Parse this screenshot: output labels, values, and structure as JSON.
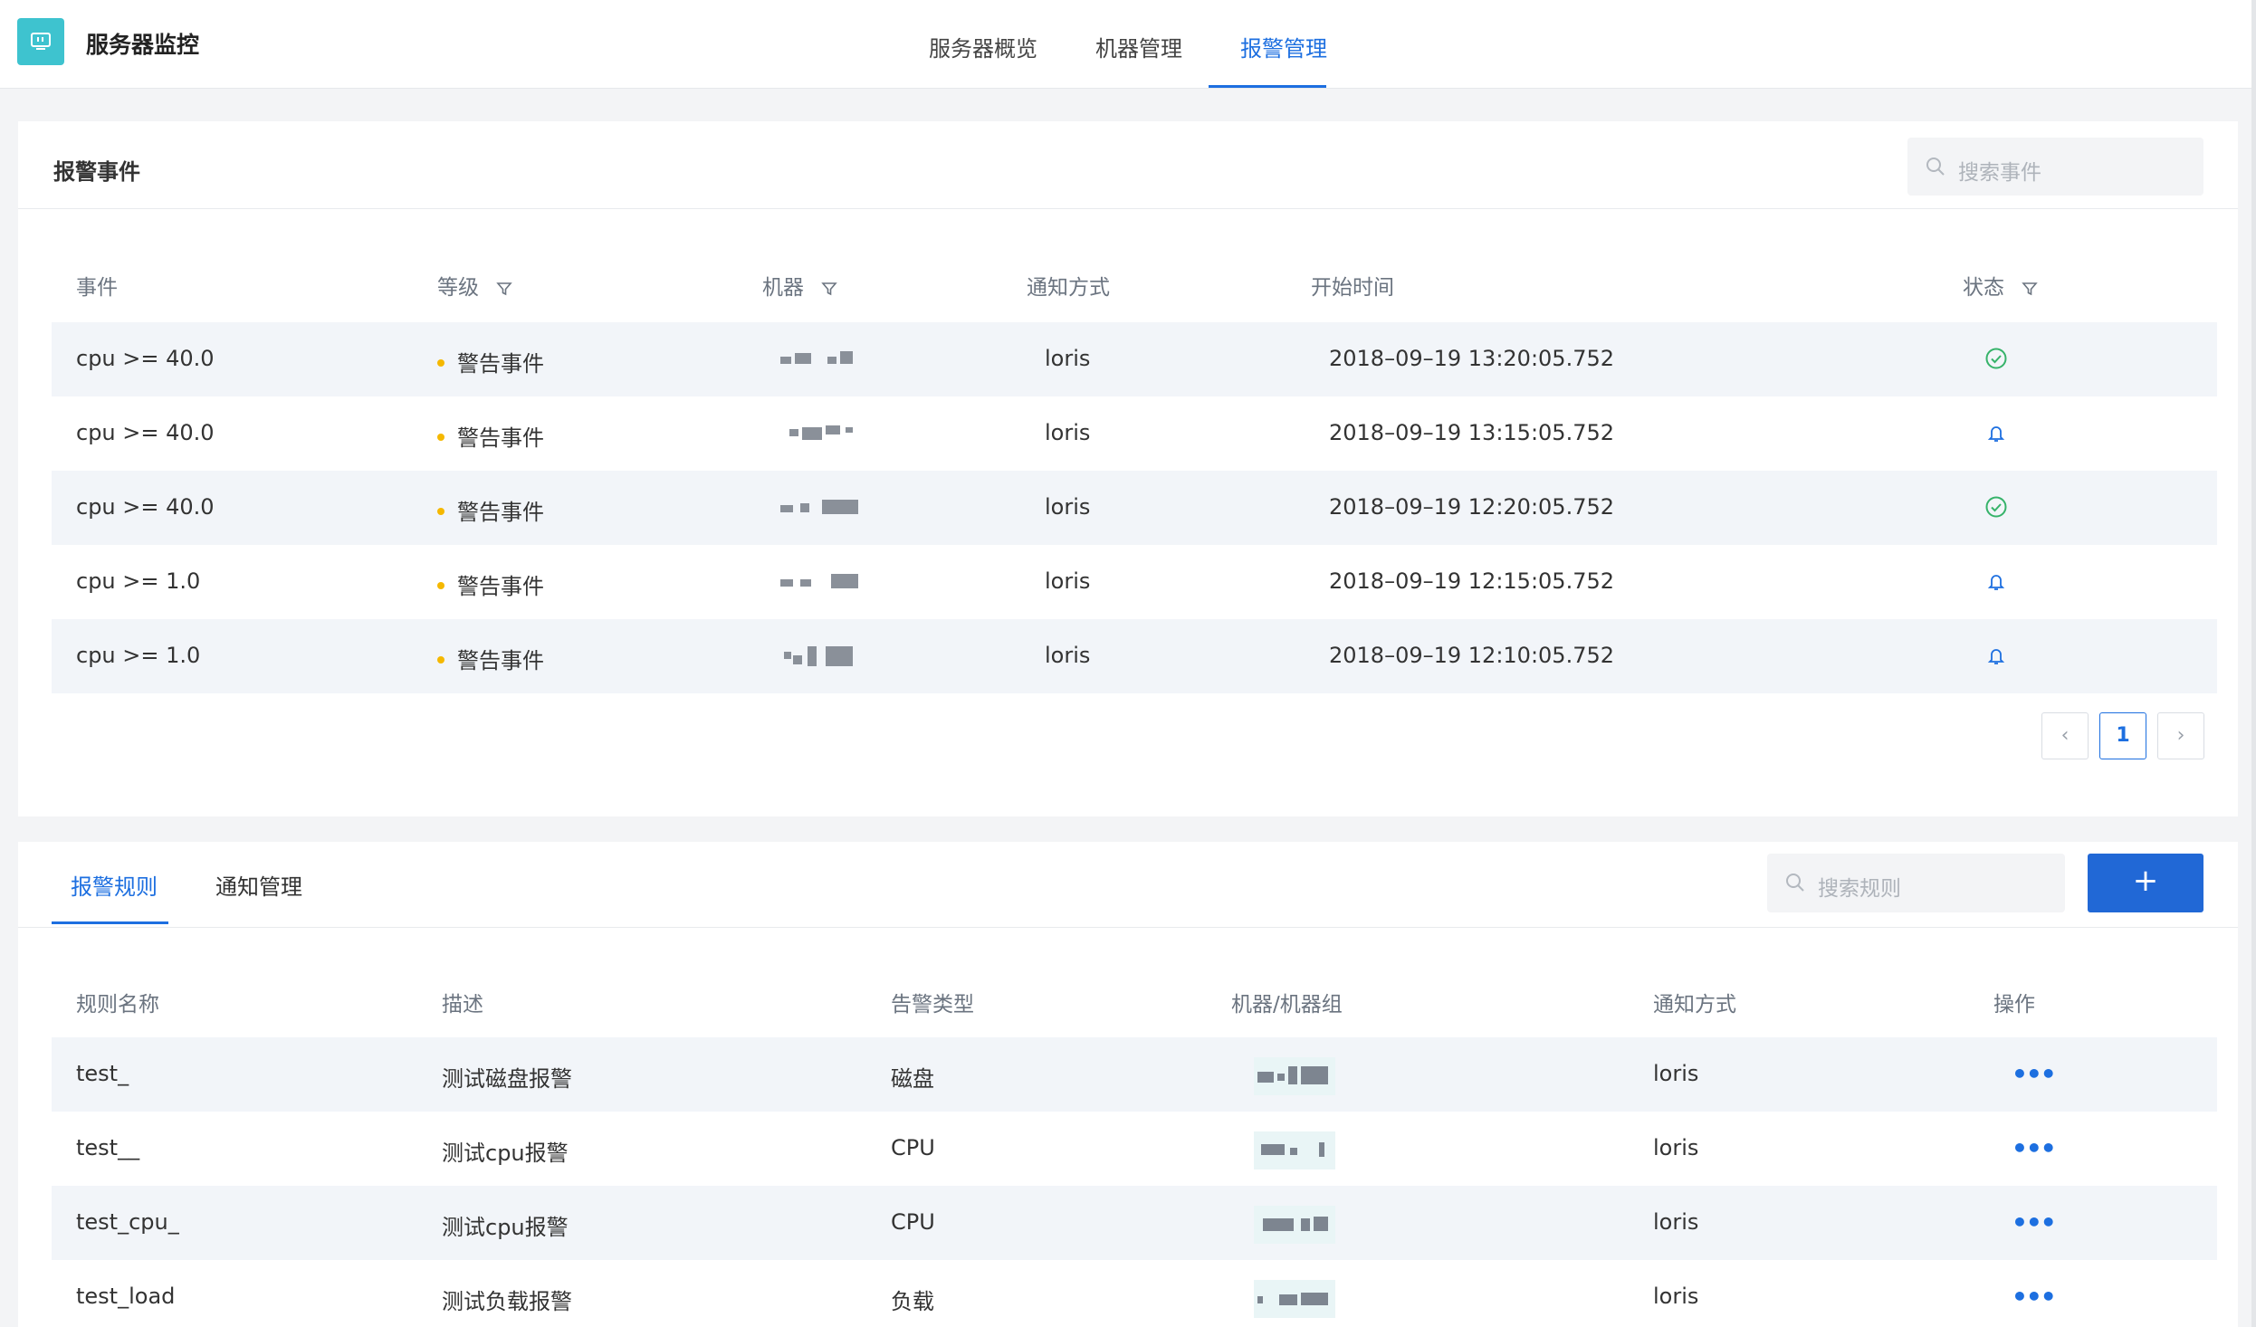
{
  "app": {
    "title": "服务器监控"
  },
  "nav": {
    "tabs": [
      {
        "label": "服务器概览"
      },
      {
        "label": "机器管理"
      },
      {
        "label": "报警管理"
      }
    ],
    "active_index": 2
  },
  "events": {
    "title": "报警事件",
    "search_placeholder": "搜索事件",
    "columns": [
      "事件",
      "等级",
      "机器",
      "通知方式",
      "开始时间",
      "状态"
    ],
    "rows": [
      {
        "event": "cpu >= 40.0",
        "level": "警告事件",
        "notify": "loris",
        "start": "2018–09–19 13:20:05.752",
        "status": "resolved"
      },
      {
        "event": "cpu >= 40.0",
        "level": "警告事件",
        "notify": "loris",
        "start": "2018–09–19 13:15:05.752",
        "status": "alerting"
      },
      {
        "event": "cpu >= 40.0",
        "level": "警告事件",
        "notify": "loris",
        "start": "2018–09–19 12:20:05.752",
        "status": "resolved"
      },
      {
        "event": "cpu >= 1.0",
        "level": "警告事件",
        "notify": "loris",
        "start": "2018–09–19 12:15:05.752",
        "status": "alerting"
      },
      {
        "event": "cpu >= 1.0",
        "level": "警告事件",
        "notify": "loris",
        "start": "2018–09–19 12:10:05.752",
        "status": "alerting"
      }
    ],
    "pagination": {
      "prev": "‹",
      "current": "1",
      "next": "›"
    }
  },
  "rules": {
    "tabs": [
      {
        "label": "报警规则"
      },
      {
        "label": "通知管理"
      }
    ],
    "active_index": 0,
    "search_placeholder": "搜索规则",
    "add_label": "+",
    "columns": [
      "规则名称",
      "描述",
      "告警类型",
      "机器/机器组",
      "通知方式",
      "操作"
    ],
    "rows": [
      {
        "name": "test_",
        "desc": "测试磁盘报警",
        "type": "磁盘",
        "notify": "loris",
        "action": "•••"
      },
      {
        "name": "test__",
        "desc": "测试cpu报警",
        "type": "CPU",
        "notify": "loris",
        "action": "•••"
      },
      {
        "name": "test_cpu_",
        "desc": "测试cpu报警",
        "type": "CPU",
        "notify": "loris",
        "action": "•••"
      },
      {
        "name": "test_load",
        "desc": "测试负载报警",
        "type": "负载",
        "notify": "loris",
        "action": "•••"
      }
    ]
  },
  "icons": {
    "logo": "monitor-icon",
    "search": "search-icon",
    "filter": "filter-icon",
    "resolved": "check-circle-icon",
    "alerting": "bell-icon",
    "more": "more-icon"
  },
  "colors": {
    "accent": "#1d6fe0",
    "logo_bg": "#3ec3cf",
    "warning_dot": "#f5b800",
    "resolved_green": "#36b36a",
    "row_shade": "#f2f5f9"
  }
}
